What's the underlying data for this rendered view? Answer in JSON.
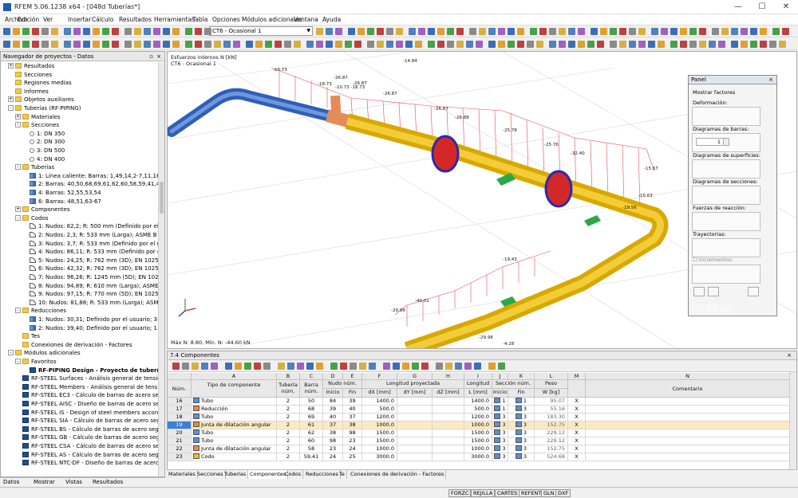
{
  "window": {
    "title": "RFEM 5.06.1238 x64 - [048d Tuberías*]",
    "min": "—",
    "max": "☐",
    "close": "✕"
  },
  "menu": [
    "Archivo",
    "Edición",
    "Ver",
    "Insertar",
    "Cálculo",
    "Resultados",
    "Herramientas",
    "Tabla",
    "Opciones",
    "Módulos adicionales",
    "Ventana",
    "Ayuda"
  ],
  "toolbar": {
    "loadcase": "CT6 - Ocasional 1"
  },
  "navigator": {
    "title": "Navegador de proyectos - Datos",
    "pin": "▫",
    "close": "×",
    "tree": [
      {
        "lvl": 1,
        "exp": "+",
        "icon": "folder",
        "label": "Resultados"
      },
      {
        "lvl": 1,
        "exp": "",
        "icon": "folder",
        "label": "Secciones"
      },
      {
        "lvl": 1,
        "exp": "",
        "icon": "folder",
        "label": "Regiones medias"
      },
      {
        "lvl": 1,
        "exp": "",
        "icon": "folder",
        "label": "Informes"
      },
      {
        "lvl": 1,
        "exp": "+",
        "icon": "folder",
        "label": "Objetos auxiliares"
      },
      {
        "lvl": 1,
        "exp": "-",
        "icon": "folder",
        "label": "Tuberías (RF-PIPING)"
      },
      {
        "lvl": 2,
        "exp": "+",
        "icon": "folder",
        "label": "Materiales"
      },
      {
        "lvl": 2,
        "exp": "-",
        "icon": "folder",
        "label": "Secciones"
      },
      {
        "lvl": 3,
        "exp": "",
        "icon": "rad",
        "label": "1: DN 350"
      },
      {
        "lvl": 3,
        "exp": "",
        "icon": "rad",
        "label": "2: DN 300"
      },
      {
        "lvl": 3,
        "exp": "",
        "icon": "rad",
        "label": "3: DN 500"
      },
      {
        "lvl": 3,
        "exp": "",
        "icon": "rad",
        "label": "4: DN 400"
      },
      {
        "lvl": 2,
        "exp": "-",
        "icon": "folder",
        "label": "Tuberías"
      },
      {
        "lvl": 3,
        "exp": "",
        "icon": "pipe",
        "label": "1: Línea caliente: Barras: 1,49,14,2-7,11,16,8"
      },
      {
        "lvl": 3,
        "exp": "",
        "icon": "pipe",
        "label": "2: Barras: 40,50,68,69,61,62,60,58,59,41,42,5"
      },
      {
        "lvl": 3,
        "exp": "",
        "icon": "pipe",
        "label": "4: Barras: 52,55,53,54"
      },
      {
        "lvl": 3,
        "exp": "",
        "icon": "pipe",
        "label": "6: Barras: 48,51,63-67"
      },
      {
        "lvl": 2,
        "exp": "+",
        "icon": "folder",
        "label": "Componentes"
      },
      {
        "lvl": 2,
        "exp": "-",
        "icon": "folder",
        "label": "Codos"
      },
      {
        "lvl": 3,
        "exp": "",
        "icon": "elb",
        "label": "1: Nudos: 82,2; R: 500 mm (Definido por el"
      },
      {
        "lvl": 3,
        "exp": "",
        "icon": "elb",
        "label": "2: Nudos: 2,3; R: 533 mm (Larga); ASME B"
      },
      {
        "lvl": 3,
        "exp": "",
        "icon": "elb",
        "label": "3: Nudos: 3,7; R: 533 mm (Definido por el u"
      },
      {
        "lvl": 3,
        "exp": "",
        "icon": "elb",
        "label": "4: Nudos: 86,11; R: 533 mm (Definido por e"
      },
      {
        "lvl": 3,
        "exp": "",
        "icon": "elb",
        "label": "5: Nudos: 24,25; R: 762 mm (3D); EN 10253"
      },
      {
        "lvl": 3,
        "exp": "",
        "icon": "elb",
        "label": "6: Nudos: 42,32; R: 762 mm (3D); EN 10253"
      },
      {
        "lvl": 3,
        "exp": "",
        "icon": "elb",
        "label": "7: Nudos: 96,26; R: 1245 mm (5D); EN 1025"
      },
      {
        "lvl": 3,
        "exp": "",
        "icon": "elb",
        "label": "8: Nudos: 94,89; R: 610 mm (Larga); ASME"
      },
      {
        "lvl": 3,
        "exp": "",
        "icon": "elb",
        "label": "9: Nudos: 97,15; R: 770 mm (5D); EN 10253"
      },
      {
        "lvl": 3,
        "exp": "",
        "icon": "elb",
        "label": "10: Nudos: 81,88; R: 533 mm (Larga); ASMI"
      },
      {
        "lvl": 2,
        "exp": "-",
        "icon": "folder",
        "label": "Reducciones"
      },
      {
        "lvl": 3,
        "exp": "",
        "icon": "red",
        "label": "1: Nudos: 30,31; Definido por el usuario; 3:"
      },
      {
        "lvl": 3,
        "exp": "",
        "icon": "red",
        "label": "2: Nudos: 39,40; Definido por el usuario; 1:"
      },
      {
        "lvl": 2,
        "exp": "",
        "icon": "folder",
        "label": "Tes"
      },
      {
        "lvl": 2,
        "exp": "",
        "icon": "folder",
        "label": "Conexiones de derivación - Factores"
      },
      {
        "lvl": 1,
        "exp": "-",
        "icon": "folder",
        "label": "Módulos adicionales"
      },
      {
        "lvl": 2,
        "exp": "-",
        "icon": "folder",
        "label": "Favoritos"
      },
      {
        "lvl": 3,
        "exp": "",
        "icon": "mod",
        "label": "RF-PIPING Design - Proyecto de tubería",
        "bold": true
      },
      {
        "lvl": 2,
        "exp": "",
        "icon": "mod",
        "label": "RF-STEEL Surfaces - Análisis general de tensio"
      },
      {
        "lvl": 2,
        "exp": "",
        "icon": "mod",
        "label": "RF-STEEL Members - Análisis general de tensio"
      },
      {
        "lvl": 2,
        "exp": "",
        "icon": "mod",
        "label": "RF-STEEL EC3 - Cálculo de barras de acero seg"
      },
      {
        "lvl": 2,
        "exp": "",
        "icon": "mod",
        "label": "RF-STEEL AISC - Diseño de barras de acero seg"
      },
      {
        "lvl": 2,
        "exp": "",
        "icon": "mod",
        "label": "RF-STEEL IS - Design of steel members accord"
      },
      {
        "lvl": 2,
        "exp": "",
        "icon": "mod",
        "label": "RF-STEEL SIA - Cálculo de barras de acero seg"
      },
      {
        "lvl": 2,
        "exp": "",
        "icon": "mod",
        "label": "RF-STEEL BS - Cálculo de barras de acero segú"
      },
      {
        "lvl": 2,
        "exp": "",
        "icon": "mod",
        "label": "RF-STEEL GB - Cálculo de barras de acero segú"
      },
      {
        "lvl": 2,
        "exp": "",
        "icon": "mod",
        "label": "RF-STEEL CSA - Cálculo de barras de acero seg"
      },
      {
        "lvl": 2,
        "exp": "",
        "icon": "mod",
        "label": "RF-STEEL AS - Cálculo de barras de acero segú"
      },
      {
        "lvl": 2,
        "exp": "",
        "icon": "mod",
        "label": "RF-STEEL NTC-DF - Diseño de barras de acero"
      }
    ],
    "tabs": [
      "Datos",
      "Mostrar",
      "Vistas",
      "Resultados"
    ]
  },
  "view": {
    "title": "Esfuerzos internos N [kN]",
    "subtitle": "CT6 : Ocasional 1",
    "minmax": "Máx N: 8.80, Mín. N: -44.60 kN",
    "labels": [
      "-10.73",
      "-18.73",
      "-26.87",
      "-10.73 -18.73",
      "-26.87",
      "-14.84",
      "-26.87",
      "-26.87",
      "-26.88",
      "-25.78",
      "-25.76",
      "-32.40",
      "-15.67",
      "-19.56",
      "-19.43",
      "-40.01",
      "-29.99",
      "-29.98",
      "-4.28",
      "-15.63"
    ]
  },
  "panel": {
    "title": "Panel",
    "close": "×",
    "show_factors": "Mostrar factores",
    "deformation": "Deformación:",
    "member_diagrams": "Diagramas de barras:",
    "member_value": "1",
    "surface_diagrams": "Diagramas de superficies:",
    "section_diagrams": "Diagramas de secciones:",
    "reactions": "Fuerzas de reacción:",
    "trajectories": "Trayectorias:",
    "increments": "Incrementos:"
  },
  "table": {
    "title": "7.4 Componentes",
    "close": "×",
    "col_letters": [
      "A",
      "B",
      "C",
      "D",
      "E",
      "F",
      "G",
      "H",
      "I",
      "J",
      "K",
      "L",
      "M",
      "N"
    ],
    "headers": {
      "num": "Núm.",
      "type": "Tipo de componente",
      "pipe": "Tubería núm.",
      "member": "Barra núm.",
      "node": "Nudo núm.",
      "start": "Inicio",
      "end": "Fin",
      "proj": "Longitud proyectada",
      "dx": "dX [mm]",
      "dy": "dY [mm]",
      "dz": "dZ [mm]",
      "length": "Longitud",
      "lunit": "L [mm]",
      "section": "Sección núm.",
      "weight": "Peso",
      "wunit": "W [kg]",
      "comment": "Comentario"
    },
    "rows": [
      {
        "num": "16",
        "color": "#5b8fd6",
        "type": "Tubo",
        "pipe": "2",
        "member": "50",
        "ns": "84",
        "ne": "39",
        "dx": "1400.0",
        "dy": "",
        "dz": "",
        "len": "1400.0",
        "ss": "1",
        "se": "1",
        "w": "95.07",
        "m": "X"
      },
      {
        "num": "17",
        "color": "#e08a4a",
        "type": "Reducción",
        "pipe": "2",
        "member": "68",
        "ns": "39",
        "ne": "40",
        "dx": "500.0",
        "dy": "",
        "dz": "",
        "len": "500.0",
        "ss": "1",
        "se": "3",
        "w": "55.16",
        "m": "X"
      },
      {
        "num": "18",
        "color": "#5b8fd6",
        "type": "Tubo",
        "pipe": "2",
        "member": "69",
        "ns": "40",
        "ne": "37",
        "dx": "1200.0",
        "dy": "",
        "dz": "",
        "len": "1200.0",
        "ss": "3",
        "se": "3",
        "w": "183.30",
        "m": "X"
      },
      {
        "num": "19",
        "color": "#e08a4a",
        "type": "Junta de dilatación angular",
        "pipe": "2",
        "member": "61",
        "ns": "37",
        "ne": "38",
        "dx": "1000.0",
        "dy": "",
        "dz": "",
        "len": "1000.0",
        "ss": "3",
        "se": "3",
        "w": "152.75",
        "m": "X",
        "sel": true
      },
      {
        "num": "20",
        "color": "#5b8fd6",
        "type": "Tubo",
        "pipe": "2",
        "member": "62",
        "ns": "38",
        "ne": "98",
        "dx": "1500.0",
        "dy": "",
        "dz": "",
        "len": "1500.0",
        "ss": "3",
        "se": "3",
        "w": "229.12",
        "m": "X"
      },
      {
        "num": "21",
        "color": "#5b8fd6",
        "type": "Tubo",
        "pipe": "2",
        "member": "60",
        "ns": "98",
        "ne": "23",
        "dx": "1500.0",
        "dy": "",
        "dz": "",
        "len": "1500.0",
        "ss": "3",
        "se": "3",
        "w": "229.12",
        "m": "X"
      },
      {
        "num": "22",
        "color": "#e08a4a",
        "type": "Junta de dilatación angular",
        "pipe": "2",
        "member": "58",
        "ns": "23",
        "ne": "24",
        "dx": "1000.0",
        "dy": "",
        "dz": "",
        "len": "1000.0",
        "ss": "3",
        "se": "3",
        "w": "152.75",
        "m": "X"
      },
      {
        "num": "23",
        "color": "#e8c030",
        "type": "Codo",
        "pipe": "2",
        "member": "59,41",
        "ns": "24",
        "ne": "25",
        "dx": "3000.0",
        "dy": "",
        "dz": "",
        "len": "3000.0",
        "ss": "3",
        "se": "3",
        "w": "524.68",
        "m": "X"
      }
    ],
    "tabs": [
      "Materiales",
      "Secciones",
      "Tuberías",
      "Componentes",
      "Codos",
      "Reducciones",
      "Te",
      "Conexiones de derivación - Factores"
    ],
    "active_tab": "Componentes"
  },
  "status": [
    "FORZC",
    "REJILLA",
    "CARTES",
    "REFENT",
    "GLN",
    "DXF"
  ]
}
